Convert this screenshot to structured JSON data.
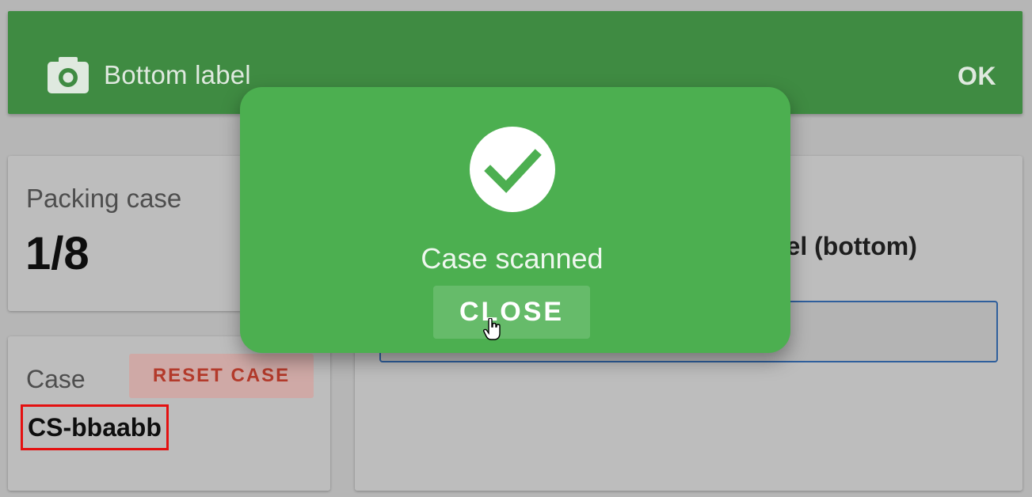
{
  "header": {
    "icon": "camera-icon",
    "title": "Bottom label",
    "ok_label": "OK"
  },
  "packing_card": {
    "label": "Packing case",
    "count": "1/8"
  },
  "case_card": {
    "label": "Case",
    "reset_label": "RESET CASE",
    "case_id": "CS-bbaabb"
  },
  "right_card": {
    "title_visible": "bel (bottom)",
    "input_value": ""
  },
  "modal": {
    "icon": "check-circle-icon",
    "message": "Case scanned",
    "close_label": "CLOSE"
  },
  "colors": {
    "header_green": "#3f8b42",
    "modal_green": "#4caf50",
    "reset_red": "#b33a2b",
    "highlight_red": "#e41010",
    "input_border_blue": "#2f5f9c"
  }
}
